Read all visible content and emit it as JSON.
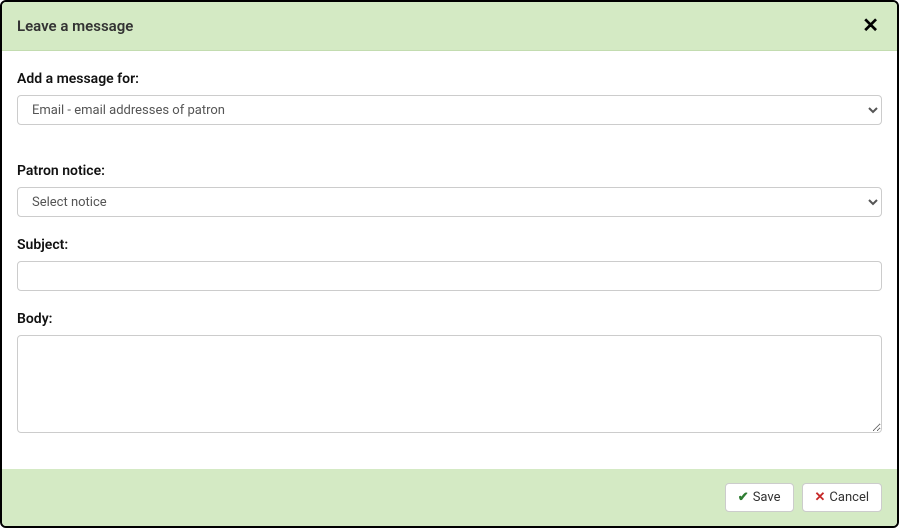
{
  "header": {
    "title": "Leave a message"
  },
  "form": {
    "message_for": {
      "label": "Add a message for:",
      "value": "Email - email addresses of patron"
    },
    "patron_notice": {
      "label": "Patron notice:",
      "value": "Select notice"
    },
    "subject": {
      "label": "Subject:",
      "value": ""
    },
    "body": {
      "label": "Body:",
      "value": ""
    }
  },
  "footer": {
    "save_label": "Save",
    "cancel_label": "Cancel"
  }
}
